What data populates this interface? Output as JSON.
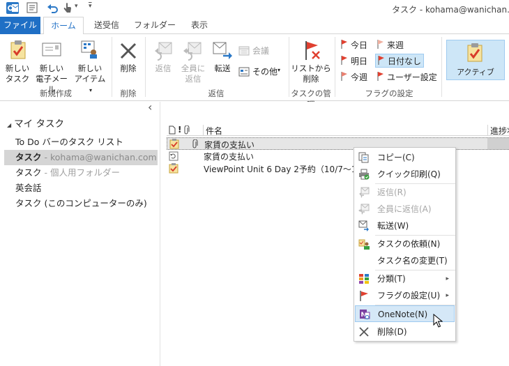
{
  "window": {
    "title": "タスク - kohama@wanichan.com"
  },
  "qat": {
    "customize_glyph": "▾",
    "undo_dropdown_glyph": "▾"
  },
  "tabs": [
    "ファイル",
    "ホーム",
    "送受信",
    "フォルダー",
    "表示"
  ],
  "ribbon": {
    "new_task": [
      "新しい",
      "タスク"
    ],
    "new_email": [
      "新しい",
      "電子メール"
    ],
    "new_items": [
      "新しい",
      "アイテム"
    ],
    "new_items_caret": "▾",
    "group_new": "新規作成",
    "delete": "削除",
    "group_delete": "削除",
    "reply": "返信",
    "reply_all": [
      "全員に",
      "返信"
    ],
    "forward": "転送",
    "meeting": "会議",
    "more": "その他",
    "more_caret": "▾",
    "group_respond": "返信",
    "remove_from_list": [
      "リストから",
      "削除"
    ],
    "group_manage": "タスクの管理",
    "flags": {
      "today": "今日",
      "tomorrow": "明日",
      "this_week": "今週",
      "next_week": "来週",
      "no_date": "日付なし",
      "custom": "ユーザー設定"
    },
    "group_flags": "フラグの設定",
    "active_view": "アクティブ"
  },
  "nav": {
    "collapse_glyph": "‹",
    "header": "マイ タスク",
    "header_glyph": "◢",
    "items": [
      {
        "label": "To Do バーのタスク リスト",
        "sub": ""
      },
      {
        "label": "タスク",
        "sub": " - kohama@wanichan.com"
      },
      {
        "label": "タスク",
        "sub": " - 個人用フォルダー"
      },
      {
        "label": "英会話",
        "sub": ""
      },
      {
        "label": "タスク (このコンピューターのみ)",
        "sub": ""
      }
    ]
  },
  "list": {
    "columns": {
      "subject": "件名",
      "progress": "進捗状"
    },
    "rows": [
      {
        "subject": "家賃の支払い"
      },
      {
        "subject": "家賃の支払い"
      },
      {
        "subject": "ViewPoint Unit 6 Day 2予約（10/7～1"
      }
    ]
  },
  "context_menu": {
    "items": [
      {
        "label": "コピー(C)",
        "enabled": true
      },
      {
        "label": "クイック印刷(Q)",
        "enabled": true
      },
      {
        "label": "返信(R)",
        "enabled": false
      },
      {
        "label": "全員に返信(A)",
        "enabled": false
      },
      {
        "label": "転送(W)",
        "enabled": true
      },
      {
        "label": "タスクの依頼(N)",
        "enabled": true
      },
      {
        "label": "タスク名の変更(T)",
        "enabled": true
      },
      {
        "label": "分類(T)",
        "enabled": true
      },
      {
        "label": "フラグの設定(U)",
        "enabled": true
      },
      {
        "label": "OneNote(N)",
        "enabled": true,
        "highlighted": true
      },
      {
        "label": "削除(D)",
        "enabled": true
      }
    ],
    "submenu_arrow": "▸"
  },
  "colors": {
    "accent": "#2b78c6",
    "file_tab": "#1f6fc5",
    "selected_bg": "#cde6f7",
    "highlight_bg": "#d5e8f7",
    "flag_red": "#e04030"
  }
}
